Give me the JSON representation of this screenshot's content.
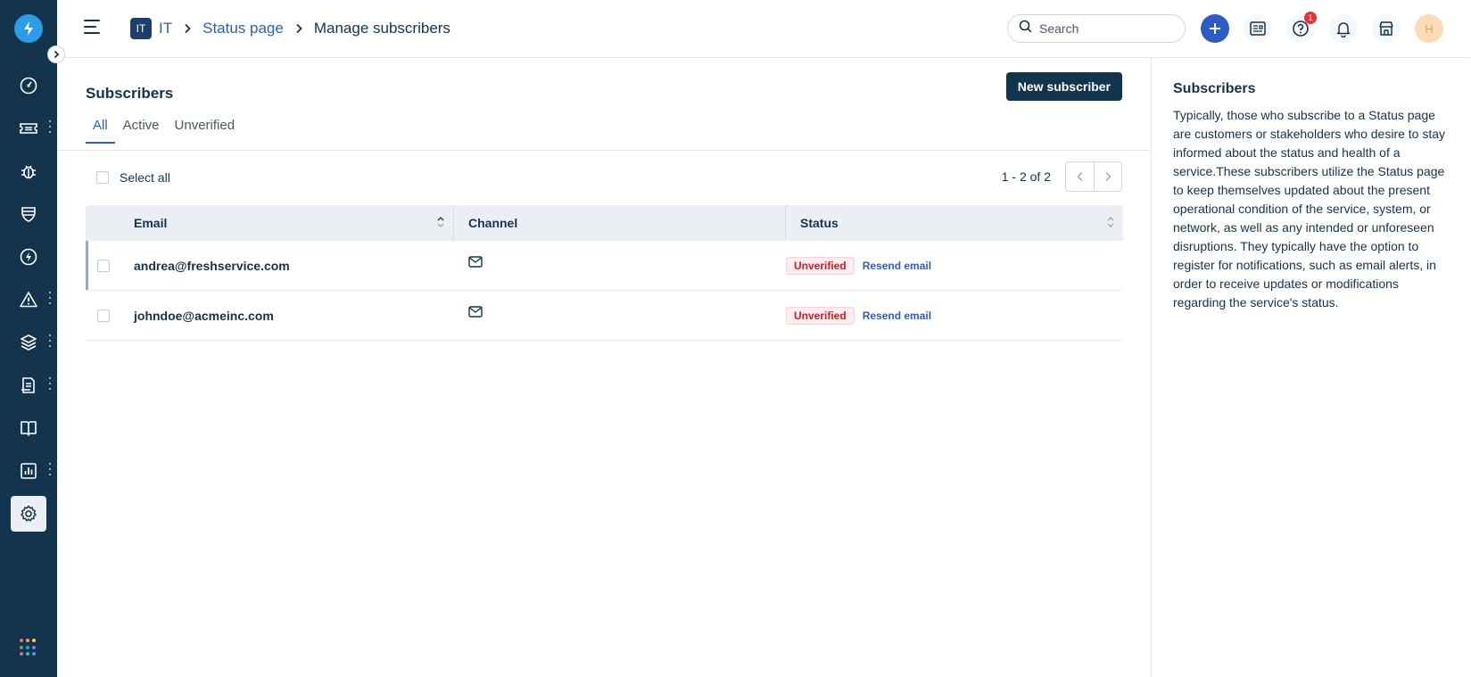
{
  "header": {
    "workspace_badge": "IT",
    "breadcrumb": [
      "IT",
      "Status page",
      "Manage subscribers"
    ],
    "search_placeholder": "Search",
    "notification_count": "1",
    "avatar_initial": "H"
  },
  "main": {
    "title": "Subscribers",
    "new_button": "New subscriber",
    "tabs": [
      "All",
      "Active",
      "Unverified"
    ],
    "active_tab": "All",
    "select_all": "Select all",
    "pagination": "1 - 2 of 2",
    "table": {
      "columns": [
        "Email",
        "Channel",
        "Status"
      ],
      "rows": [
        {
          "email": "andrea@freshservice.com",
          "channel": "mail-icon",
          "status": "Unverified",
          "action": "Resend email"
        },
        {
          "email": "johndoe@acmeinc.com",
          "channel": "mail-icon",
          "status": "Unverified",
          "action": "Resend email"
        }
      ]
    }
  },
  "help": {
    "title": "Subscribers",
    "text": "Typically, those who subscribe to a Status page are customers or stakeholders who desire to stay informed about the status and health of a service.These subscribers utilize the Status page to keep themselves updated about the present operational condition of the service, system, or network, as well as any intended or unforeseen disruptions. They typically have the option to register for notifications, such as email alerts, in order to receive updates or modifications regarding the service's status."
  },
  "colors": {
    "nav_bg": "#12344d",
    "accent": "#2c5cc5",
    "logo": "#2c9be8",
    "unverified": "#c82124"
  },
  "icons": {
    "nav": [
      "dashboard-icon",
      "tickets-icon",
      "problems-icon",
      "changes-icon",
      "releases-icon",
      "alerts-icon",
      "assets-icon",
      "contracts-icon",
      "solutions-icon",
      "analytics-icon",
      "admin-settings-icon"
    ]
  }
}
